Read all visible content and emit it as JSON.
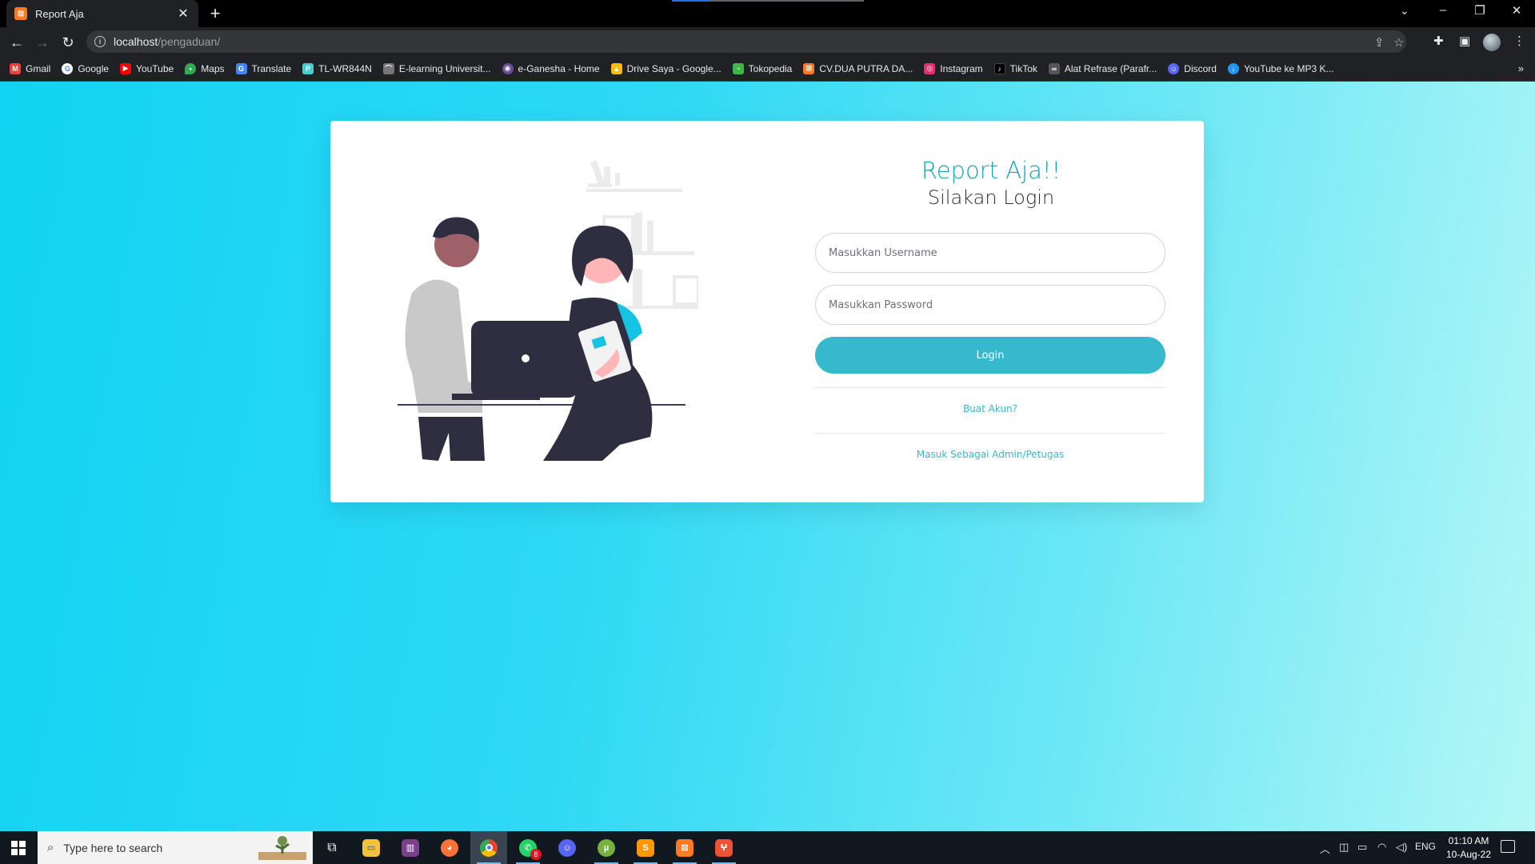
{
  "browser": {
    "tab_title": "Report Aja",
    "tab_favicon": "xampp-icon",
    "url_host": "localhost",
    "url_path": "/pengaduan/",
    "bookmarks": [
      {
        "label": "Gmail",
        "icon": "gmail-icon",
        "color": "#ea4335"
      },
      {
        "label": "Google",
        "icon": "google-icon",
        "color": "#4285f4"
      },
      {
        "label": "YouTube",
        "icon": "youtube-icon",
        "color": "#ff0000"
      },
      {
        "label": "Maps",
        "icon": "maps-icon",
        "color": "#34a853"
      },
      {
        "label": "Translate",
        "icon": "translate-icon",
        "color": "#4285f4"
      },
      {
        "label": "TL-WR844N",
        "icon": "tplink-icon",
        "color": "#4acbd6"
      },
      {
        "label": "E-learning Universit...",
        "icon": "elearning-icon",
        "color": "#777777"
      },
      {
        "label": "e-Ganesha - Home",
        "icon": "eganesha-icon",
        "color": "#6a4c93"
      },
      {
        "label": "Drive Saya - Google...",
        "icon": "drive-icon",
        "color": "#fbbc04"
      },
      {
        "label": "Tokopedia",
        "icon": "tokopedia-icon",
        "color": "#42b549"
      },
      {
        "label": "CV.DUA PUTRA DA...",
        "icon": "xampp-icon",
        "color": "#fb7a24"
      },
      {
        "label": "Instagram",
        "icon": "instagram-icon",
        "color": "#e1306c"
      },
      {
        "label": "TikTok",
        "icon": "tiktok-icon",
        "color": "#000000"
      },
      {
        "label": "Alat Refrase (Parafr...",
        "icon": "refrase-icon",
        "color": "#555555"
      },
      {
        "label": "Discord",
        "icon": "discord-icon",
        "color": "#5865f2"
      },
      {
        "label": "YouTube ke MP3 K...",
        "icon": "download-icon",
        "color": "#2196f3"
      }
    ]
  },
  "page": {
    "brand_title": "Report Aja!!",
    "subtitle": "Silakan Login",
    "username_placeholder": "Masukkan Username",
    "password_placeholder": "Masukkan Password",
    "login_label": "Login",
    "create_account_label": "Buat Akun?",
    "admin_login_label": "Masuk Sebagai Admin/Petugas",
    "accent_color": "#36b9cc",
    "brand_color": "#17a2b8"
  },
  "taskbar": {
    "search_placeholder": "Type here to search",
    "whatsapp_badge": "8",
    "language": "ENG",
    "time": "01:10 AM",
    "date": "10-Aug-22",
    "apps": [
      "task-view-icon",
      "file-explorer-icon",
      "winrar-icon",
      "firefox-icon",
      "chrome-icon",
      "whatsapp-icon",
      "discord-icon",
      "utorrent-icon",
      "sublime-text-icon",
      "xampp-icon",
      "git-icon"
    ]
  }
}
